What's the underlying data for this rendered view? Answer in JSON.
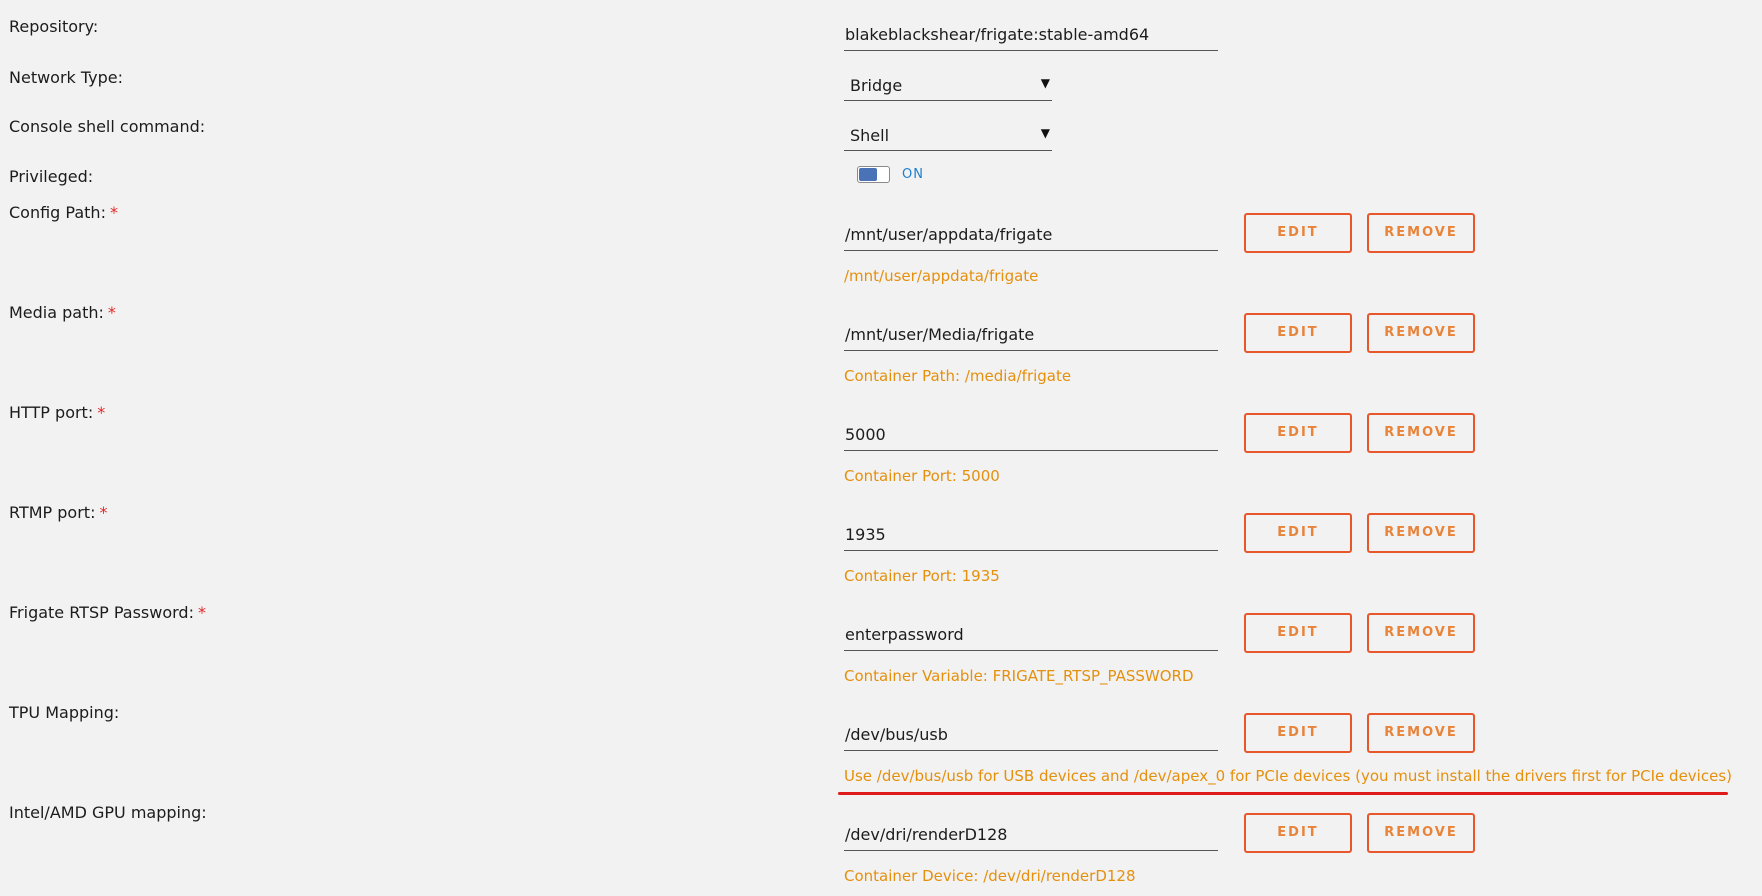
{
  "repository": {
    "label": "Repository:",
    "value": "blakeblackshear/frigate:stable-amd64"
  },
  "network_type": {
    "label": "Network Type:",
    "value": "Bridge"
  },
  "console_shell": {
    "label": "Console shell command:",
    "value": "Shell"
  },
  "privileged": {
    "label": "Privileged:",
    "state": "ON"
  },
  "buttons": {
    "edit": "EDIT",
    "remove": "REMOVE"
  },
  "required_marker": "*",
  "config_path": {
    "label": "Config Path:",
    "value": "/mnt/user/appdata/frigate",
    "hint": "/mnt/user/appdata/frigate"
  },
  "media_path": {
    "label": "Media path:",
    "value": "/mnt/user/Media/frigate",
    "hint": "Container Path: /media/frigate"
  },
  "http_port": {
    "label": "HTTP port:",
    "value": "5000",
    "hint": "Container Port: 5000"
  },
  "rtmp_port": {
    "label": "RTMP port:",
    "value": "1935",
    "hint": "Container Port: 1935"
  },
  "rtsp_password": {
    "label": "Frigate RTSP Password:",
    "value": "enterpassword",
    "hint": "Container Variable: FRIGATE_RTSP_PASSWORD"
  },
  "tpu_mapping": {
    "label": "TPU Mapping:",
    "value": "/dev/bus/usb",
    "hint": "Use /dev/bus/usb for USB devices and /dev/apex_0 for PCIe devices (you must install the drivers first for PCIe devices)"
  },
  "gpu_mapping": {
    "label": "Intel/AMD GPU mapping:",
    "value": "/dev/dri/renderD128",
    "hint": "Container Device: /dev/dri/renderD128"
  },
  "colors": {
    "background": "#f2f2f2",
    "accent_orange": "#e5900d",
    "button_border": "#e8572b",
    "required_red": "#e22828",
    "toggle_blue": "#4a72b6",
    "annotation_red": "#e01a1a"
  }
}
